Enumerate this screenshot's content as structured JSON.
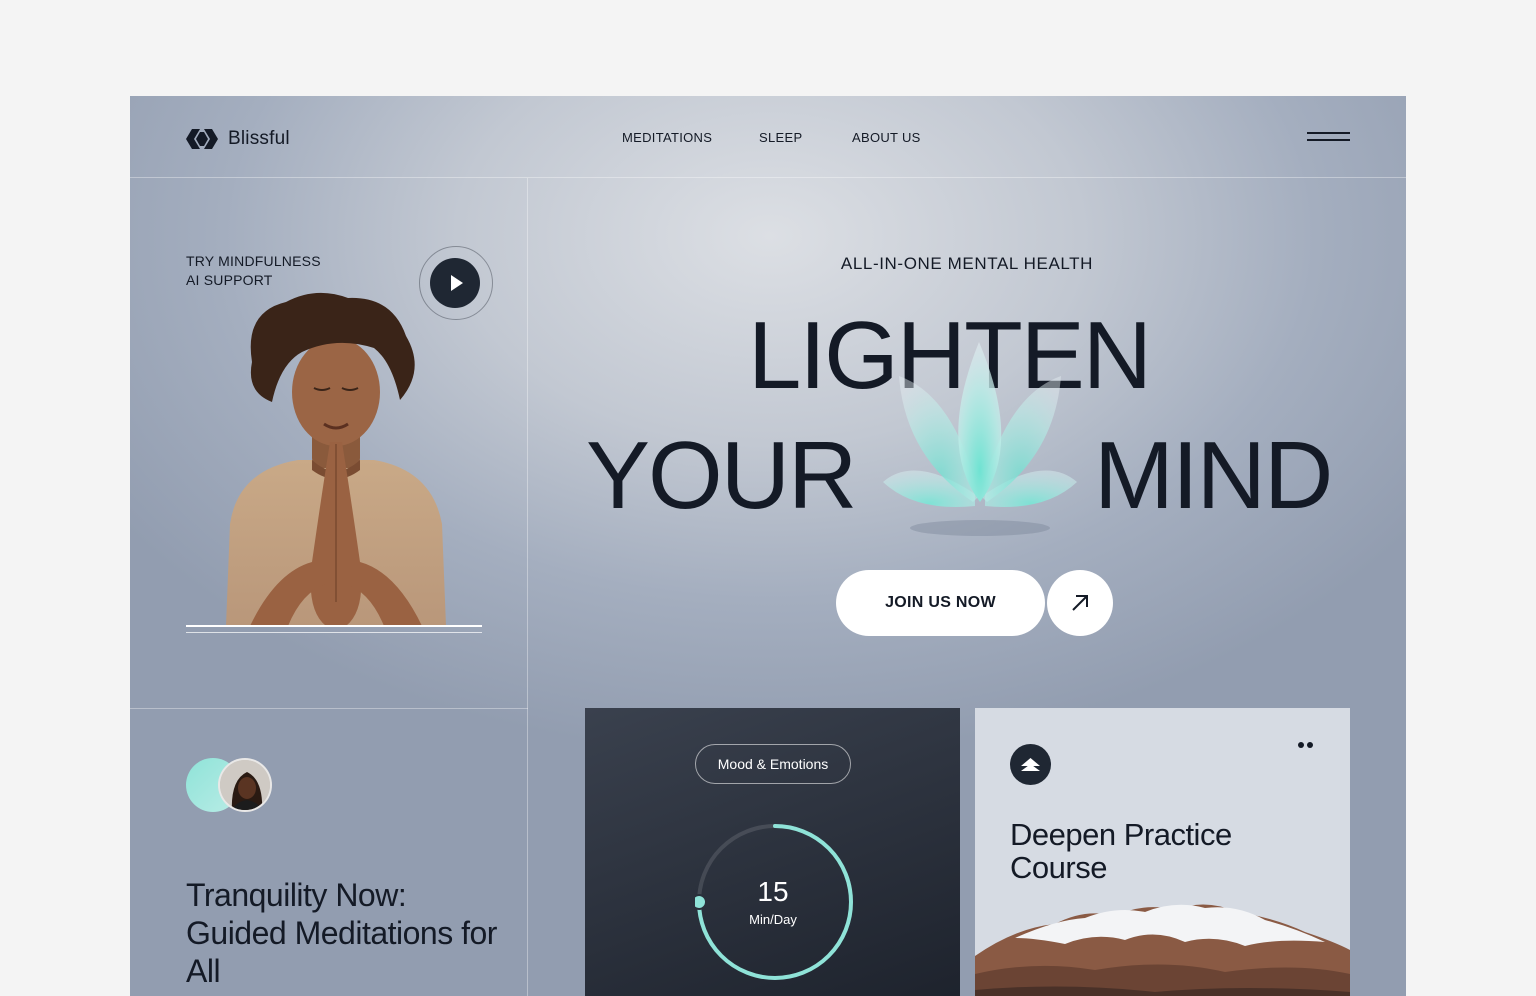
{
  "brand": {
    "name": "Blissful"
  },
  "nav": {
    "items": [
      "MEDITATIONS",
      "SLEEP",
      "ABOUT US"
    ]
  },
  "hero_left": {
    "try_line1": "TRY MINDFULNESS",
    "try_line2": "AI SUPPORT"
  },
  "hero": {
    "kicker": "ALL-IN-ONE MENTAL HEALTH",
    "line1": "LIGHTEN",
    "line2_left": "YOUR",
    "line2_right": "MIND",
    "cta": "JOIN US NOW"
  },
  "bottom_left": {
    "title": "Tranquility Now: Guided Meditations for All"
  },
  "mood_card": {
    "tag": "Mood & Emotions",
    "value": "15",
    "unit": "Min/Day",
    "progress": 0.75
  },
  "course_card": {
    "title": "Deepen Practice Course"
  },
  "colors": {
    "accent": "#8fe3d8",
    "dark": "#1f2733",
    "text": "#141a26"
  }
}
